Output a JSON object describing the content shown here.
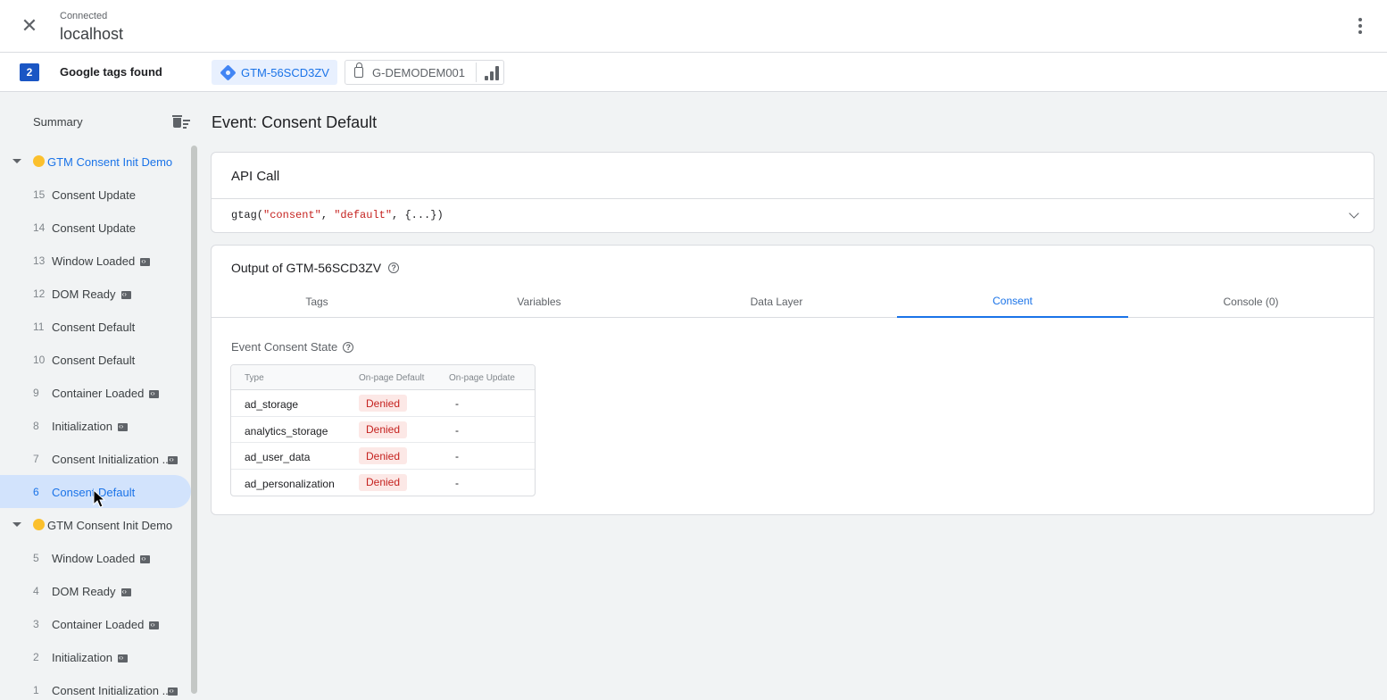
{
  "header": {
    "status": "Connected",
    "host": "localhost"
  },
  "tagsbar": {
    "count": "2",
    "label": "Google tags found",
    "gtm_chip": "GTM-56SCD3ZV",
    "ga_chip": "G-DEMODEM001"
  },
  "sidebar": {
    "summary": "Summary",
    "groups": [
      {
        "name": "GTM Consent Init Demo",
        "items": [
          {
            "num": "15",
            "label": "Consent Update"
          },
          {
            "num": "14",
            "label": "Consent Update"
          },
          {
            "num": "13",
            "label": "Window Loaded"
          },
          {
            "num": "12",
            "label": "DOM Ready"
          },
          {
            "num": "11",
            "label": "Consent Default"
          },
          {
            "num": "10",
            "label": "Consent Default"
          },
          {
            "num": "9",
            "label": "Container Loaded"
          },
          {
            "num": "8",
            "label": "Initialization"
          },
          {
            "num": "7",
            "label": "Consent Initialization ..."
          },
          {
            "num": "6",
            "label": "Consent Default"
          }
        ]
      },
      {
        "name": "GTM Consent Init Demo",
        "items": [
          {
            "num": "5",
            "label": "Window Loaded"
          },
          {
            "num": "4",
            "label": "DOM Ready"
          },
          {
            "num": "3",
            "label": "Container Loaded"
          },
          {
            "num": "2",
            "label": "Initialization"
          },
          {
            "num": "1",
            "label": "Consent Initialization ..."
          }
        ]
      }
    ]
  },
  "main": {
    "event_title": "Event: Consent Default",
    "api_card": {
      "title": "API Call",
      "code_fn": "gtag(",
      "code_arg1": "\"consent\"",
      "code_sep1": ", ",
      "code_arg2": "\"default\"",
      "code_rest": ", {...})"
    },
    "output_card": {
      "title": "Output of GTM-56SCD3ZV",
      "tabs": [
        "Tags",
        "Variables",
        "Data Layer",
        "Consent",
        "Console (0)"
      ],
      "active_tab": "Consent",
      "state_title": "Event Consent State",
      "table": {
        "headers": [
          "Type",
          "On-page Default",
          "On-page Update"
        ],
        "rows": [
          {
            "type": "ad_storage",
            "default": "Denied",
            "update": "-"
          },
          {
            "type": "analytics_storage",
            "default": "Denied",
            "update": "-"
          },
          {
            "type": "ad_user_data",
            "default": "Denied",
            "update": "-"
          },
          {
            "type": "ad_personalization",
            "default": "Denied",
            "update": "-"
          }
        ]
      }
    }
  },
  "colors": {
    "accent": "#1a73e8",
    "badge": "#1a56c4",
    "denied_bg": "#fce8e6",
    "denied_text": "#c5221f",
    "group_dot": "#fbc02d"
  }
}
